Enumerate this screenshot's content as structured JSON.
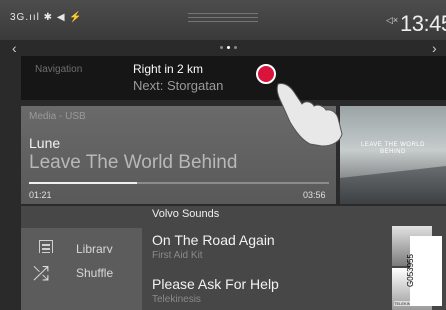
{
  "status_bar": {
    "signal_text": "3G.ııl ✱ ◀ ⚡",
    "clock": "13:45"
  },
  "navigation": {
    "title": "Navigation",
    "instruction": "Right in 2 km",
    "next": "Next: Storgatan"
  },
  "media": {
    "source": "Media - USB",
    "artist": "Lune",
    "track": "Leave The World Behind",
    "elapsed": "01:21",
    "total": "03:56",
    "progress": 0.36,
    "album_title": "LEAVE THE WORLD BEHIND"
  },
  "browse": {
    "header": "Volvo Sounds",
    "library_label": "Library",
    "shuffle_label": "Shuffle",
    "items": [
      {
        "title": "On The Road Again",
        "subtitle": "First Aid Kit"
      },
      {
        "title": "Please Ask For Help",
        "subtitle": "Telekinesis"
      }
    ],
    "thumb_tag": "TELEKINESIS"
  },
  "figure_id": "G053955",
  "colors": {
    "touch_dot": "#d8143a",
    "background": "#2a2a2a"
  }
}
